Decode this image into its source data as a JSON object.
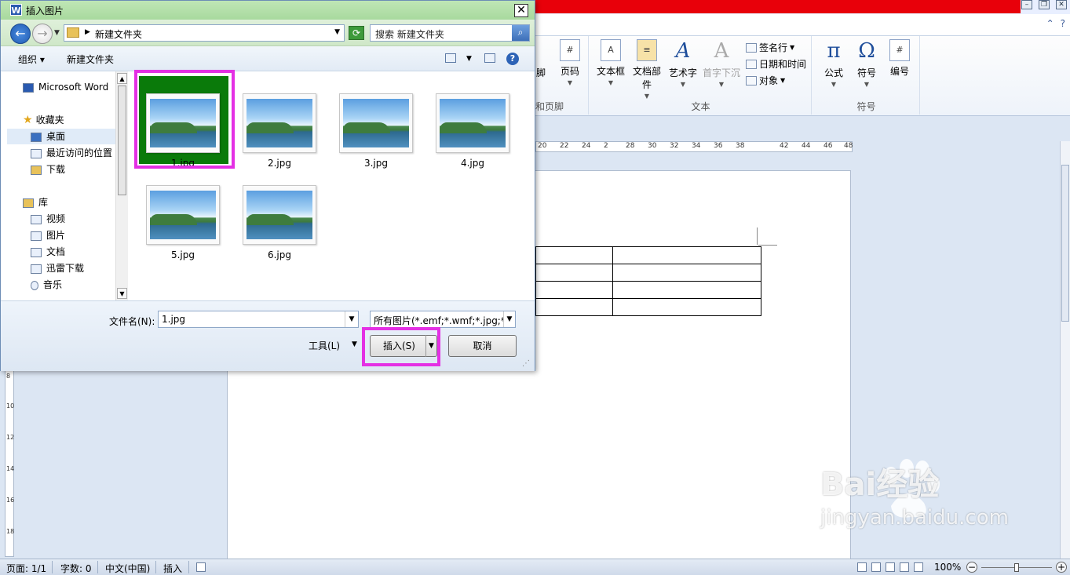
{
  "dialog": {
    "title": "插入图片",
    "app_logo": "W",
    "close_label": "✕",
    "address": {
      "path": "新建文件夹",
      "search_placeholder": "搜索 新建文件夹"
    },
    "toolbar": {
      "organize": "组织 ▾",
      "new_folder": "新建文件夹"
    },
    "nav": {
      "items": [
        {
          "label": "Microsoft Word",
          "icon": "word-icon"
        },
        {
          "label": "收藏夹",
          "icon": "star-icon"
        },
        {
          "label": "桌面",
          "icon": "desktop-icon",
          "selected": true
        },
        {
          "label": "最近访问的位置",
          "icon": "recent-icon"
        },
        {
          "label": "下载",
          "icon": "download-folder-icon"
        },
        {
          "label": "库",
          "icon": "library-icon"
        },
        {
          "label": "视频",
          "icon": "video-icon"
        },
        {
          "label": "图片",
          "icon": "pictures-icon"
        },
        {
          "label": "文档",
          "icon": "documents-icon"
        },
        {
          "label": "迅雷下载",
          "icon": "xunlei-icon"
        },
        {
          "label": "音乐",
          "icon": "music-icon"
        }
      ]
    },
    "files": [
      {
        "name": "1.jpg",
        "selected": true
      },
      {
        "name": "2.jpg"
      },
      {
        "name": "3.jpg"
      },
      {
        "name": "4.jpg"
      },
      {
        "name": "5.jpg"
      },
      {
        "name": "6.jpg"
      }
    ],
    "filename_label": "文件名(N):",
    "filename_value": "1.jpg",
    "filetype_value": "所有图片(*.emf;*.wmf;*.jpg;*.jp",
    "tools_label": "工具(L)",
    "insert_label": "插入(S)",
    "cancel_label": "取消",
    "colors": {
      "selection": "#0a7a0a",
      "highlight": "#e430e4",
      "title_bar": "#b4e0aa"
    }
  },
  "word": {
    "ribbon": {
      "header_footer": {
        "footer_partial": "脚",
        "page_number": "页码",
        "group_label_partial": "和页脚"
      },
      "text_group": {
        "label": "文本",
        "text_box": "文本框",
        "quick_parts": "文档部件",
        "wordart": "艺术字",
        "drop_cap": "首字下沉",
        "signature_line": "签名行",
        "date_time": "日期和时间",
        "object": "对象"
      },
      "symbols_group": {
        "label": "符号",
        "equation": "公式",
        "symbol": "符号",
        "number": "编号"
      }
    },
    "ruler_ticks": [
      "20",
      "22",
      "24",
      "2",
      "28",
      "30",
      "32",
      "34",
      "36",
      "38",
      "42",
      "44",
      "46",
      "48"
    ],
    "vruler_ticks": [
      "8",
      "10",
      "12",
      "14",
      "16",
      "18"
    ],
    "status": {
      "page": "页面: 1/1",
      "words": "字数: 0",
      "language": "中文(中国)",
      "mode": "插入",
      "zoom": "100%",
      "zoom_level_percent": 100
    },
    "watermark": {
      "line1": "Bai经验",
      "line2": "jingyan.baidu.com"
    }
  }
}
